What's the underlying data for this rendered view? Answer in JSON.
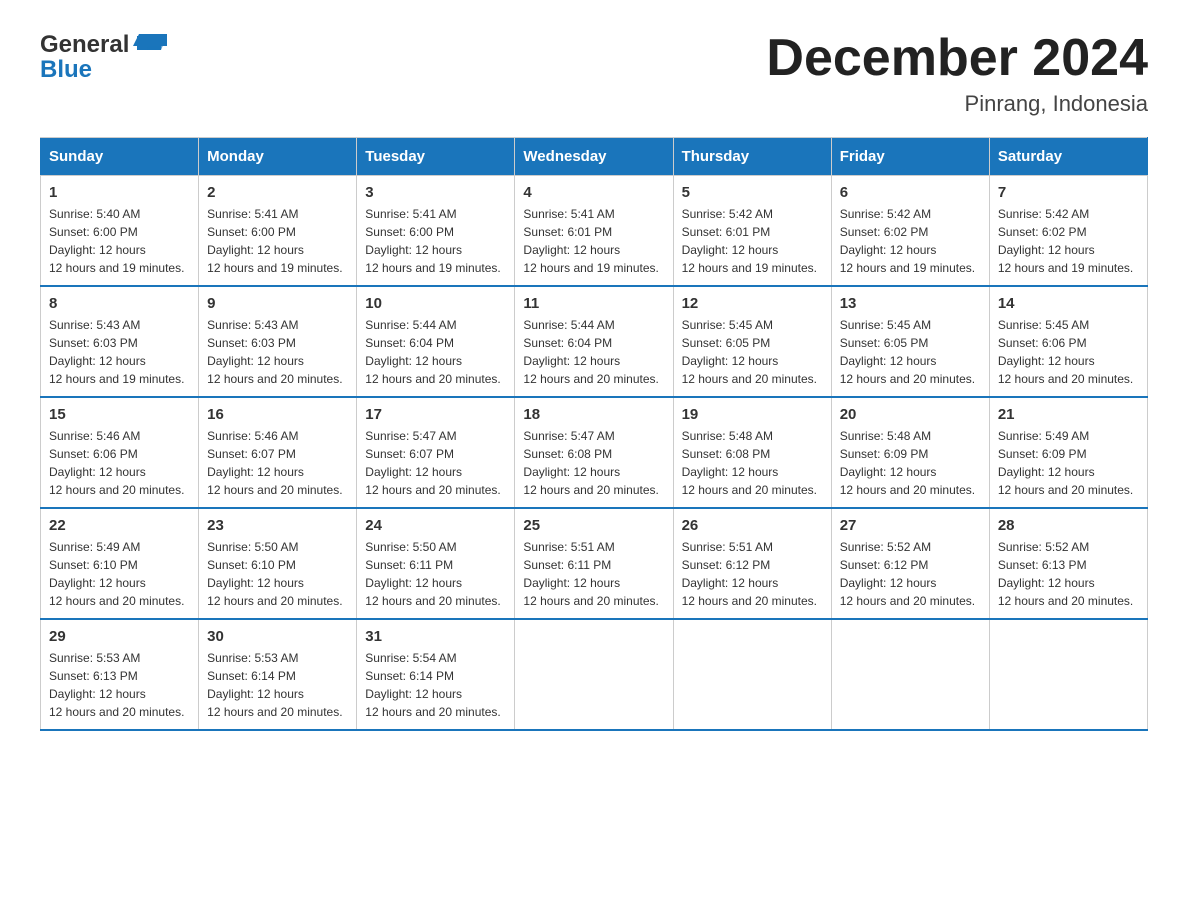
{
  "header": {
    "logo_general": "General",
    "logo_blue": "Blue",
    "title": "December 2024",
    "subtitle": "Pinrang, Indonesia"
  },
  "weekdays": [
    "Sunday",
    "Monday",
    "Tuesday",
    "Wednesday",
    "Thursday",
    "Friday",
    "Saturday"
  ],
  "weeks": [
    [
      {
        "day": "1",
        "sunrise": "5:40 AM",
        "sunset": "6:00 PM",
        "daylight": "12 hours and 19 minutes."
      },
      {
        "day": "2",
        "sunrise": "5:41 AM",
        "sunset": "6:00 PM",
        "daylight": "12 hours and 19 minutes."
      },
      {
        "day": "3",
        "sunrise": "5:41 AM",
        "sunset": "6:00 PM",
        "daylight": "12 hours and 19 minutes."
      },
      {
        "day": "4",
        "sunrise": "5:41 AM",
        "sunset": "6:01 PM",
        "daylight": "12 hours and 19 minutes."
      },
      {
        "day": "5",
        "sunrise": "5:42 AM",
        "sunset": "6:01 PM",
        "daylight": "12 hours and 19 minutes."
      },
      {
        "day": "6",
        "sunrise": "5:42 AM",
        "sunset": "6:02 PM",
        "daylight": "12 hours and 19 minutes."
      },
      {
        "day": "7",
        "sunrise": "5:42 AM",
        "sunset": "6:02 PM",
        "daylight": "12 hours and 19 minutes."
      }
    ],
    [
      {
        "day": "8",
        "sunrise": "5:43 AM",
        "sunset": "6:03 PM",
        "daylight": "12 hours and 19 minutes."
      },
      {
        "day": "9",
        "sunrise": "5:43 AM",
        "sunset": "6:03 PM",
        "daylight": "12 hours and 20 minutes."
      },
      {
        "day": "10",
        "sunrise": "5:44 AM",
        "sunset": "6:04 PM",
        "daylight": "12 hours and 20 minutes."
      },
      {
        "day": "11",
        "sunrise": "5:44 AM",
        "sunset": "6:04 PM",
        "daylight": "12 hours and 20 minutes."
      },
      {
        "day": "12",
        "sunrise": "5:45 AM",
        "sunset": "6:05 PM",
        "daylight": "12 hours and 20 minutes."
      },
      {
        "day": "13",
        "sunrise": "5:45 AM",
        "sunset": "6:05 PM",
        "daylight": "12 hours and 20 minutes."
      },
      {
        "day": "14",
        "sunrise": "5:45 AM",
        "sunset": "6:06 PM",
        "daylight": "12 hours and 20 minutes."
      }
    ],
    [
      {
        "day": "15",
        "sunrise": "5:46 AM",
        "sunset": "6:06 PM",
        "daylight": "12 hours and 20 minutes."
      },
      {
        "day": "16",
        "sunrise": "5:46 AM",
        "sunset": "6:07 PM",
        "daylight": "12 hours and 20 minutes."
      },
      {
        "day": "17",
        "sunrise": "5:47 AM",
        "sunset": "6:07 PM",
        "daylight": "12 hours and 20 minutes."
      },
      {
        "day": "18",
        "sunrise": "5:47 AM",
        "sunset": "6:08 PM",
        "daylight": "12 hours and 20 minutes."
      },
      {
        "day": "19",
        "sunrise": "5:48 AM",
        "sunset": "6:08 PM",
        "daylight": "12 hours and 20 minutes."
      },
      {
        "day": "20",
        "sunrise": "5:48 AM",
        "sunset": "6:09 PM",
        "daylight": "12 hours and 20 minutes."
      },
      {
        "day": "21",
        "sunrise": "5:49 AM",
        "sunset": "6:09 PM",
        "daylight": "12 hours and 20 minutes."
      }
    ],
    [
      {
        "day": "22",
        "sunrise": "5:49 AM",
        "sunset": "6:10 PM",
        "daylight": "12 hours and 20 minutes."
      },
      {
        "day": "23",
        "sunrise": "5:50 AM",
        "sunset": "6:10 PM",
        "daylight": "12 hours and 20 minutes."
      },
      {
        "day": "24",
        "sunrise": "5:50 AM",
        "sunset": "6:11 PM",
        "daylight": "12 hours and 20 minutes."
      },
      {
        "day": "25",
        "sunrise": "5:51 AM",
        "sunset": "6:11 PM",
        "daylight": "12 hours and 20 minutes."
      },
      {
        "day": "26",
        "sunrise": "5:51 AM",
        "sunset": "6:12 PM",
        "daylight": "12 hours and 20 minutes."
      },
      {
        "day": "27",
        "sunrise": "5:52 AM",
        "sunset": "6:12 PM",
        "daylight": "12 hours and 20 minutes."
      },
      {
        "day": "28",
        "sunrise": "5:52 AM",
        "sunset": "6:13 PM",
        "daylight": "12 hours and 20 minutes."
      }
    ],
    [
      {
        "day": "29",
        "sunrise": "5:53 AM",
        "sunset": "6:13 PM",
        "daylight": "12 hours and 20 minutes."
      },
      {
        "day": "30",
        "sunrise": "5:53 AM",
        "sunset": "6:14 PM",
        "daylight": "12 hours and 20 minutes."
      },
      {
        "day": "31",
        "sunrise": "5:54 AM",
        "sunset": "6:14 PM",
        "daylight": "12 hours and 20 minutes."
      },
      null,
      null,
      null,
      null
    ]
  ],
  "labels": {
    "sunrise": "Sunrise:",
    "sunset": "Sunset:",
    "daylight": "Daylight:"
  }
}
